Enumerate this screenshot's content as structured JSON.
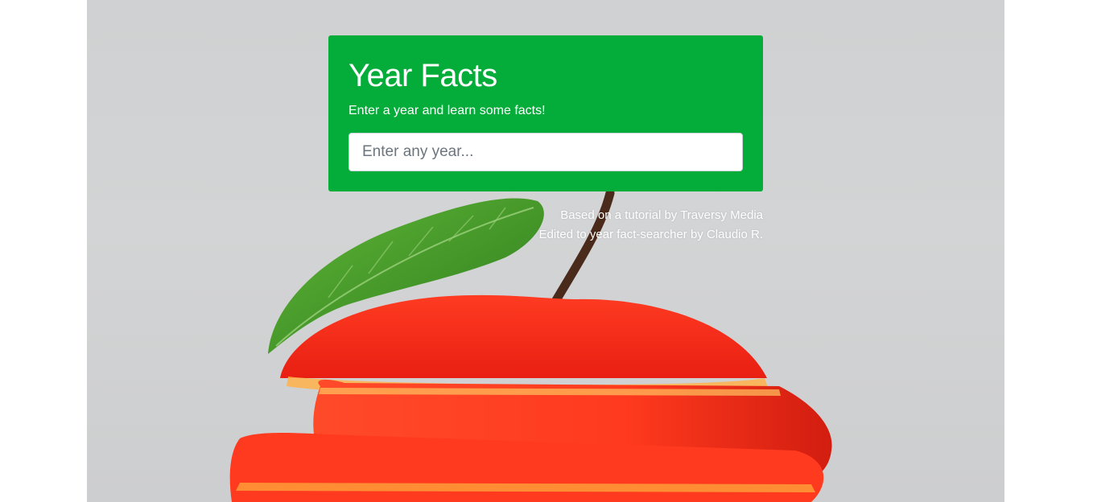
{
  "background": {
    "image_subject": "sliced-red-apple-with-mint-leaf",
    "page_color": "#ffffff",
    "backdrop_color": "#d0d1d2"
  },
  "card": {
    "title": "Year Facts",
    "subtitle": "Enter a year and learn some facts!",
    "color": "#04ad3a"
  },
  "search": {
    "placeholder": "Enter any year...",
    "value": ""
  },
  "credits": {
    "line1": "Based on a tutorial by Traversy Media",
    "line2": "Edited to year fact-searcher by Claudio R."
  }
}
